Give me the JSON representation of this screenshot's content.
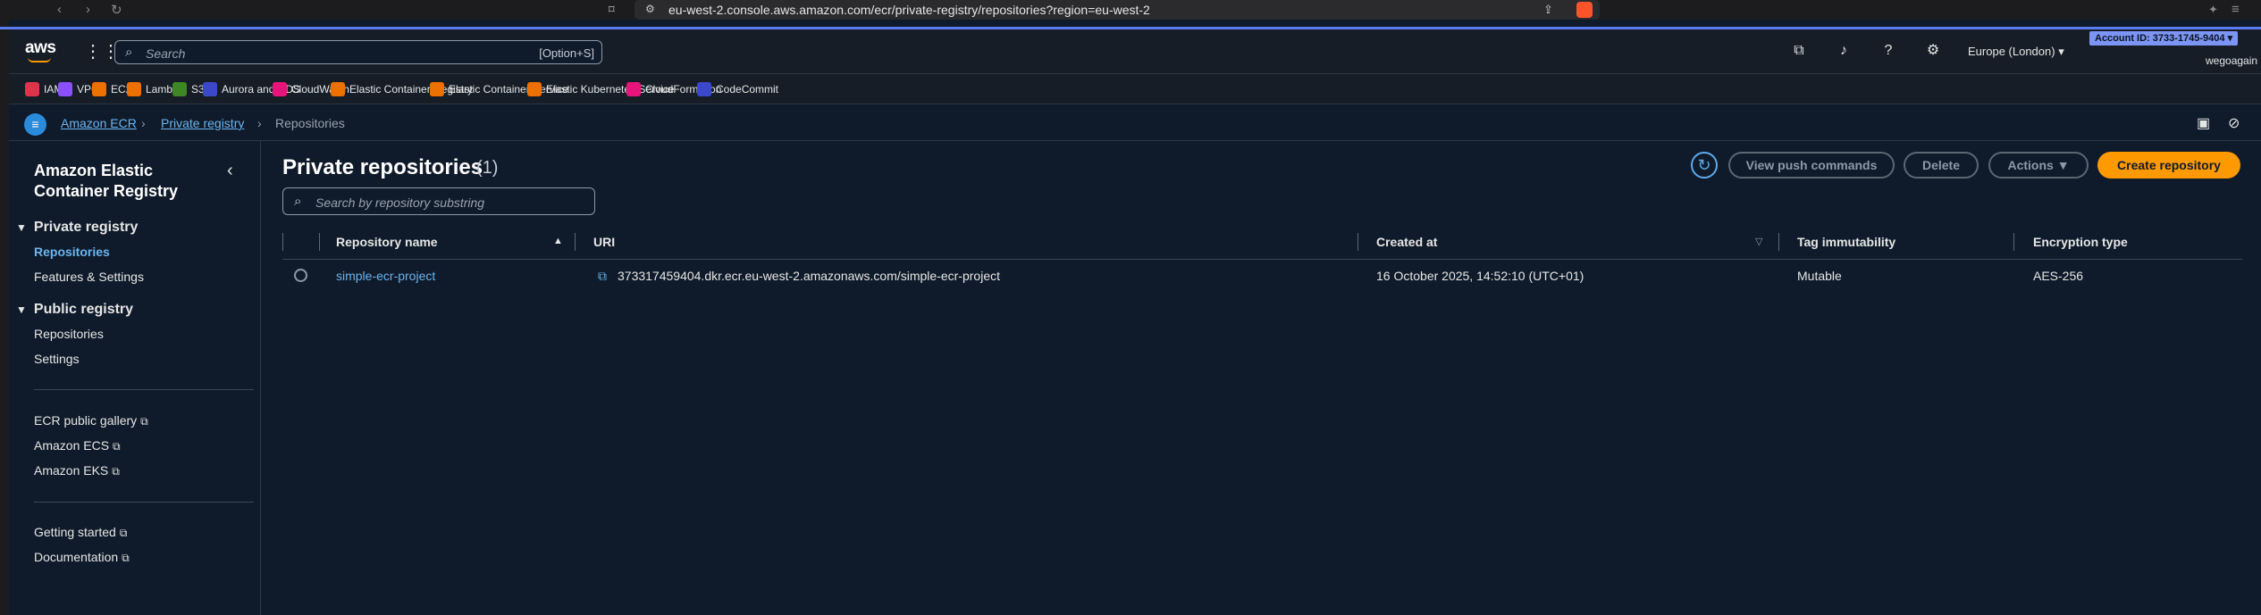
{
  "browser": {
    "url": "eu-west-2.console.aws.amazon.com/ecr/private-registry/repositories?region=eu-west-2"
  },
  "topnav": {
    "logo": "aws",
    "search_placeholder": "Search",
    "search_shortcut": "[Option+S]",
    "region": "Europe (London)",
    "account": "Account ID: 3733-1745-9404",
    "user": "wegoagain"
  },
  "favorites": [
    {
      "label": "IAM",
      "color": "#dd344c"
    },
    {
      "label": "VPC",
      "color": "#8c4fff"
    },
    {
      "label": "EC2",
      "color": "#ed7100"
    },
    {
      "label": "Lambda",
      "color": "#ed7100"
    },
    {
      "label": "S3",
      "color": "#3f8624"
    },
    {
      "label": "Aurora and RDS",
      "color": "#3b48cc"
    },
    {
      "label": "CloudWatch",
      "color": "#e7157b"
    },
    {
      "label": "Elastic Container Registry",
      "color": "#ed7100"
    },
    {
      "label": "Elastic Container Service",
      "color": "#ed7100"
    },
    {
      "label": "Elastic Kubernetes Service",
      "color": "#ed7100"
    },
    {
      "label": "CloudFormation",
      "color": "#e7157b"
    },
    {
      "label": "CodeCommit",
      "color": "#3b48cc"
    }
  ],
  "breadcrumb": {
    "items": [
      "Amazon ECR",
      "Private registry",
      "Repositories"
    ]
  },
  "sidenav": {
    "title": "Amazon Elastic Container Registry",
    "private_section": "Private registry",
    "private_items": [
      "Repositories",
      "Features & Settings"
    ],
    "public_section": "Public registry",
    "public_items": [
      "Repositories",
      "Settings"
    ],
    "links1": [
      "ECR public gallery",
      "Amazon ECS",
      "Amazon EKS"
    ],
    "links2": [
      "Getting started",
      "Documentation"
    ]
  },
  "main": {
    "title": "Private repositories",
    "count": "(1)",
    "buttons": {
      "view_push": "View push commands",
      "delete": "Delete",
      "actions": "Actions",
      "create": "Create repository"
    },
    "search_placeholder": "Search by repository substring",
    "columns": [
      "Repository name",
      "URI",
      "Created at",
      "Tag immutability",
      "Encryption type"
    ],
    "rows": [
      {
        "name": "simple-ecr-project",
        "uri": "373317459404.dkr.ecr.eu-west-2.amazonaws.com/simple-ecr-project",
        "created": "16 October 2025, 14:52:10 (UTC+01)",
        "immutability": "Mutable",
        "encryption": "AES-256"
      }
    ]
  },
  "colors": {
    "accent_orange": "#ff9900",
    "link_blue": "#6cb4f0",
    "background": "#0f1b2a"
  }
}
